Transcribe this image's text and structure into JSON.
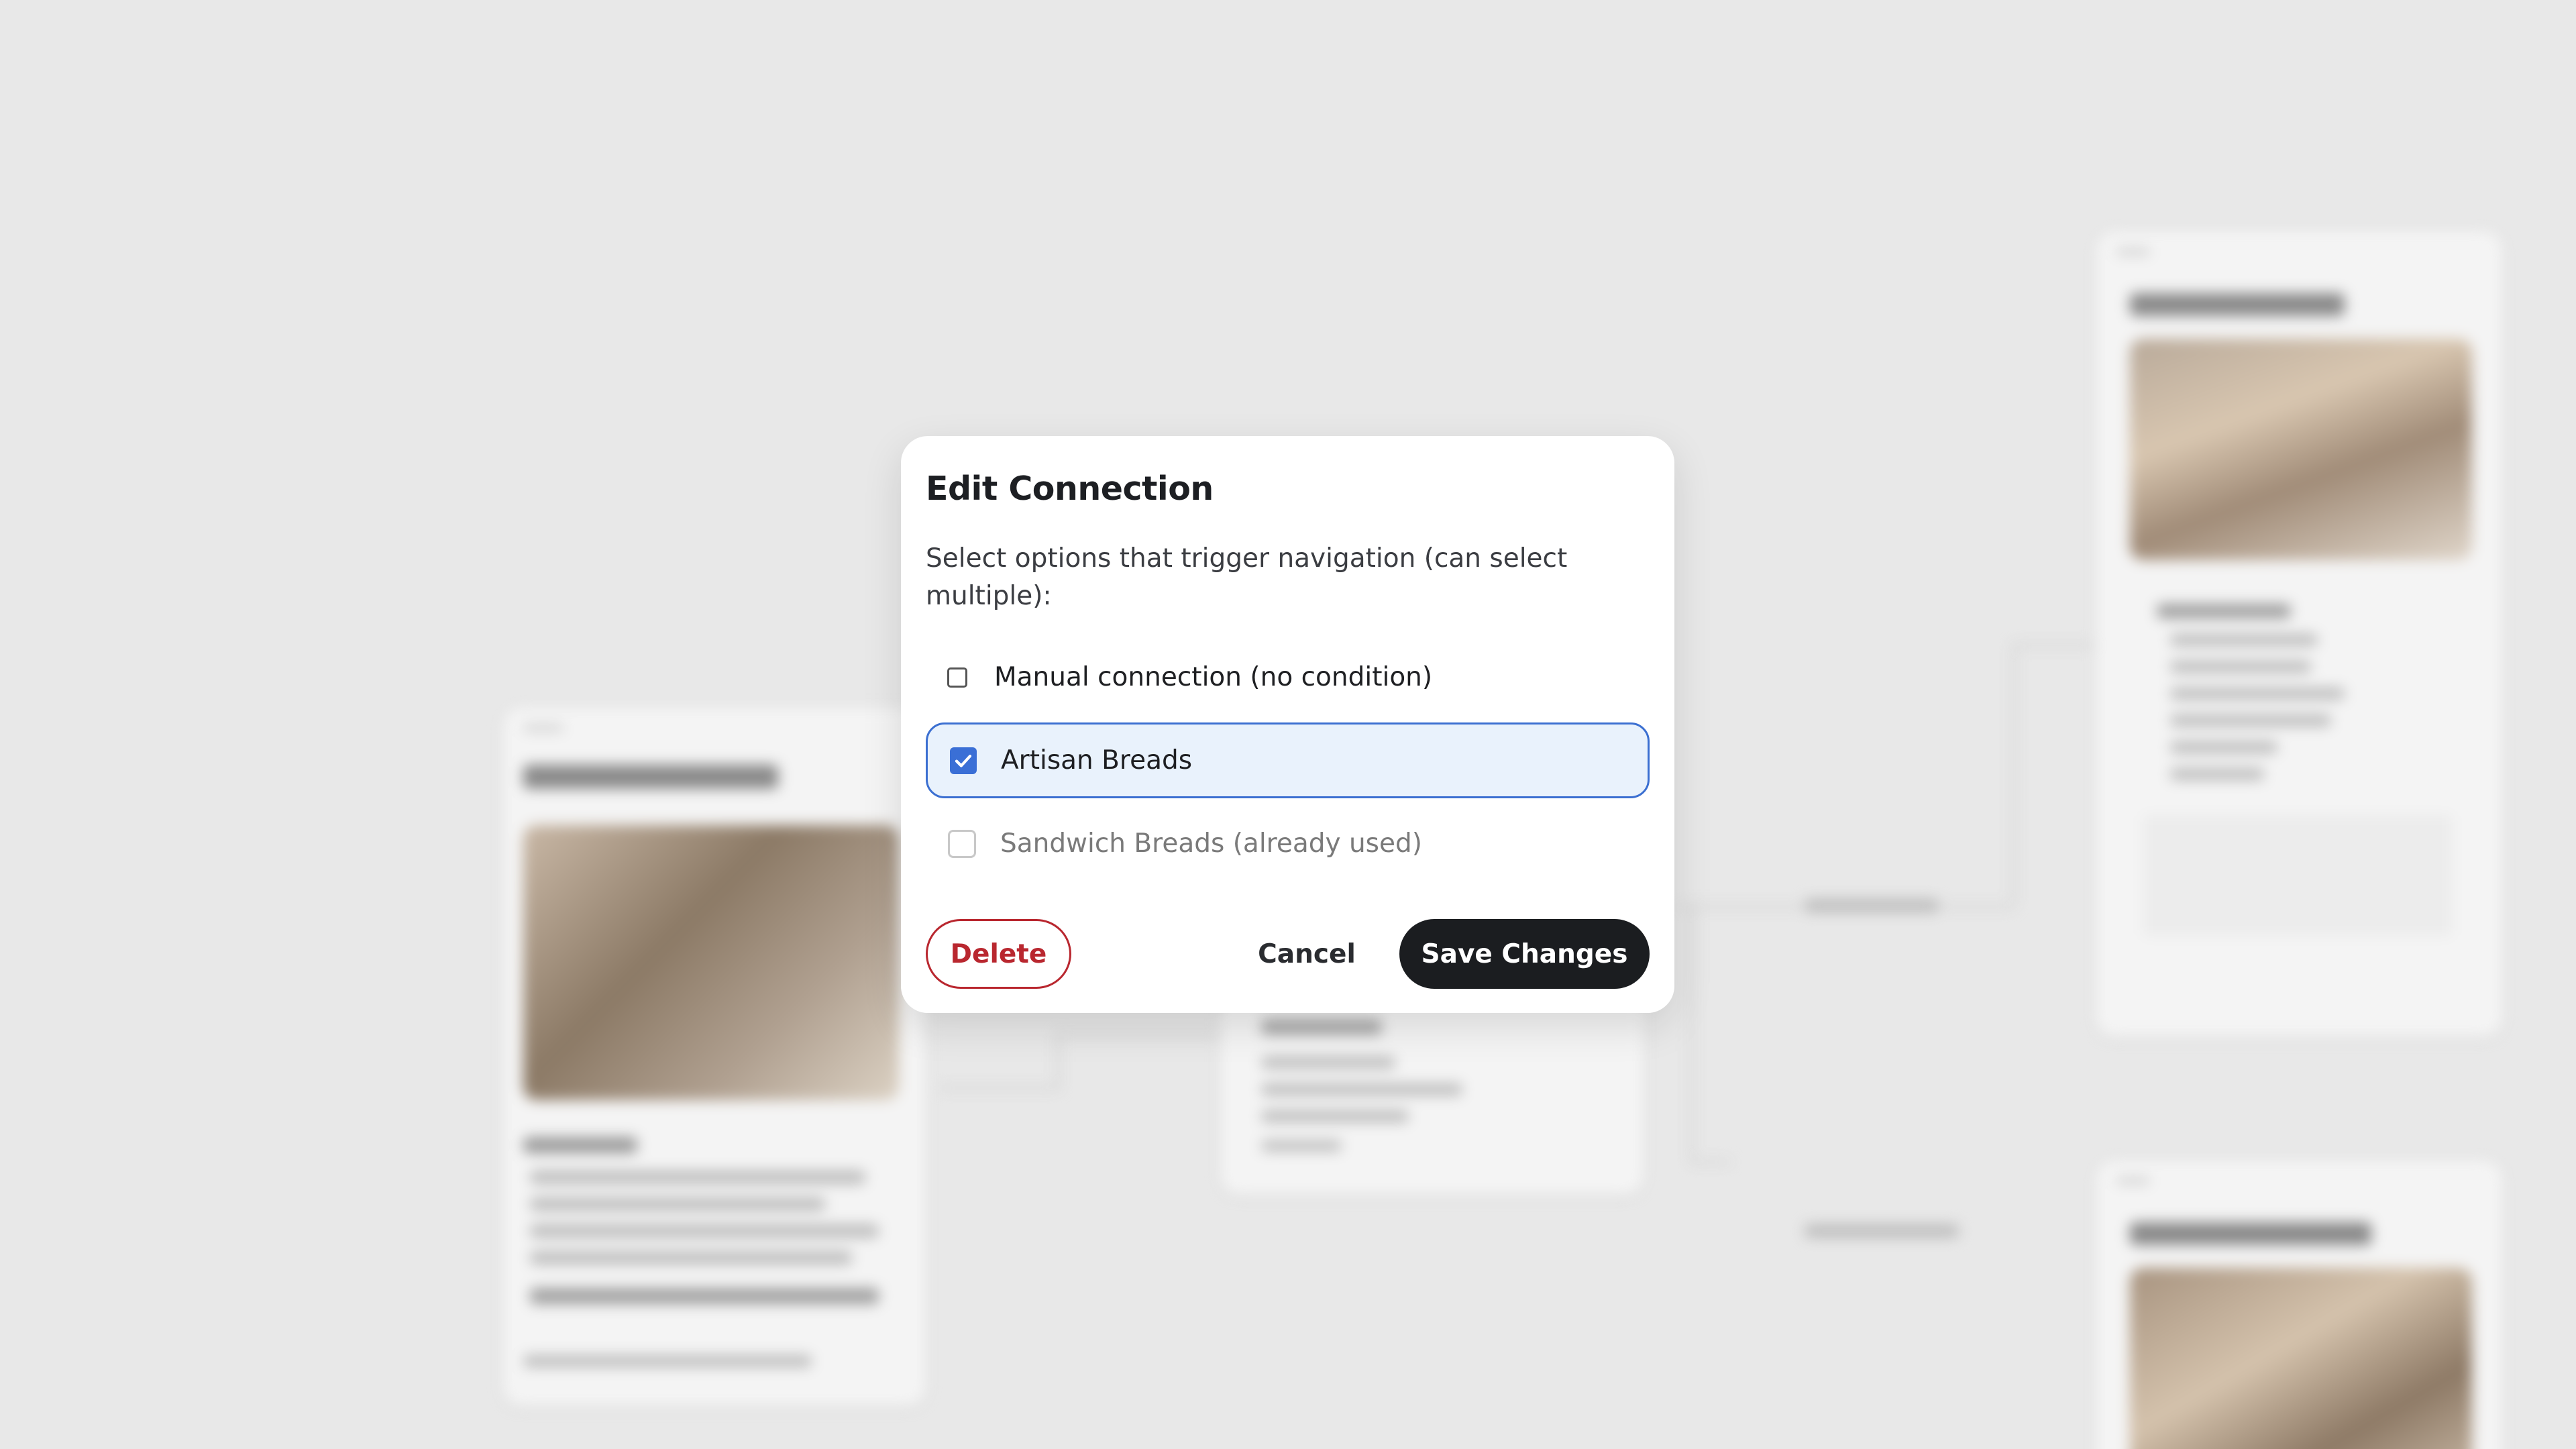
{
  "dialog": {
    "title": "Edit Connection",
    "description": "Select options that trigger navigation (can select multiple):",
    "options": [
      {
        "label": "Manual connection (no condition)",
        "checked": false,
        "disabled": false
      },
      {
        "label": "Artisan Breads",
        "checked": true,
        "disabled": false
      },
      {
        "label": "Sandwich Breads (already used)",
        "checked": false,
        "disabled": true
      }
    ],
    "buttons": {
      "delete": "Delete",
      "cancel": "Cancel",
      "save": "Save Changes"
    }
  },
  "colors": {
    "accent": "#3a6fd6",
    "selected_bg": "#e9f2fc",
    "danger": "#b9272f",
    "primary_button": "#1b1d20",
    "backdrop": "#e8e8e8"
  }
}
